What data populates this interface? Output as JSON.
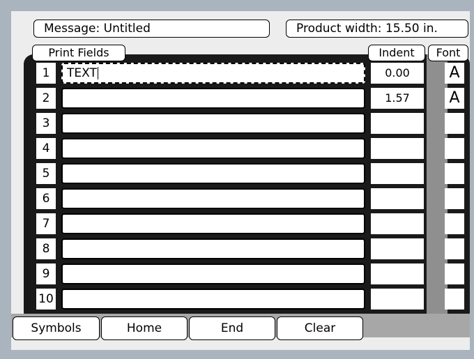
{
  "header": {
    "message_label": "Message: Untitled",
    "product_width_label": "Product width: 15.50 in."
  },
  "tabs": {
    "print_fields": "Print Fields",
    "indent": "Indent",
    "font": "Font"
  },
  "rows": [
    {
      "num": "1",
      "text": "TEXT",
      "indent": "0.00",
      "font": "A",
      "active": true
    },
    {
      "num": "2",
      "text": "",
      "indent": "1.57",
      "font": "A"
    },
    {
      "num": "3",
      "text": "",
      "indent": "",
      "font": ""
    },
    {
      "num": "4",
      "text": "",
      "indent": "",
      "font": ""
    },
    {
      "num": "5",
      "text": "",
      "indent": "",
      "font": ""
    },
    {
      "num": "6",
      "text": "",
      "indent": "",
      "font": ""
    },
    {
      "num": "7",
      "text": "",
      "indent": "",
      "font": ""
    },
    {
      "num": "8",
      "text": "",
      "indent": "",
      "font": ""
    },
    {
      "num": "9",
      "text": "",
      "indent": "",
      "font": ""
    },
    {
      "num": "10",
      "text": "",
      "indent": "",
      "font": ""
    }
  ],
  "buttons": {
    "symbols": "Symbols",
    "home": "Home",
    "end": "End",
    "clear": "Clear"
  }
}
